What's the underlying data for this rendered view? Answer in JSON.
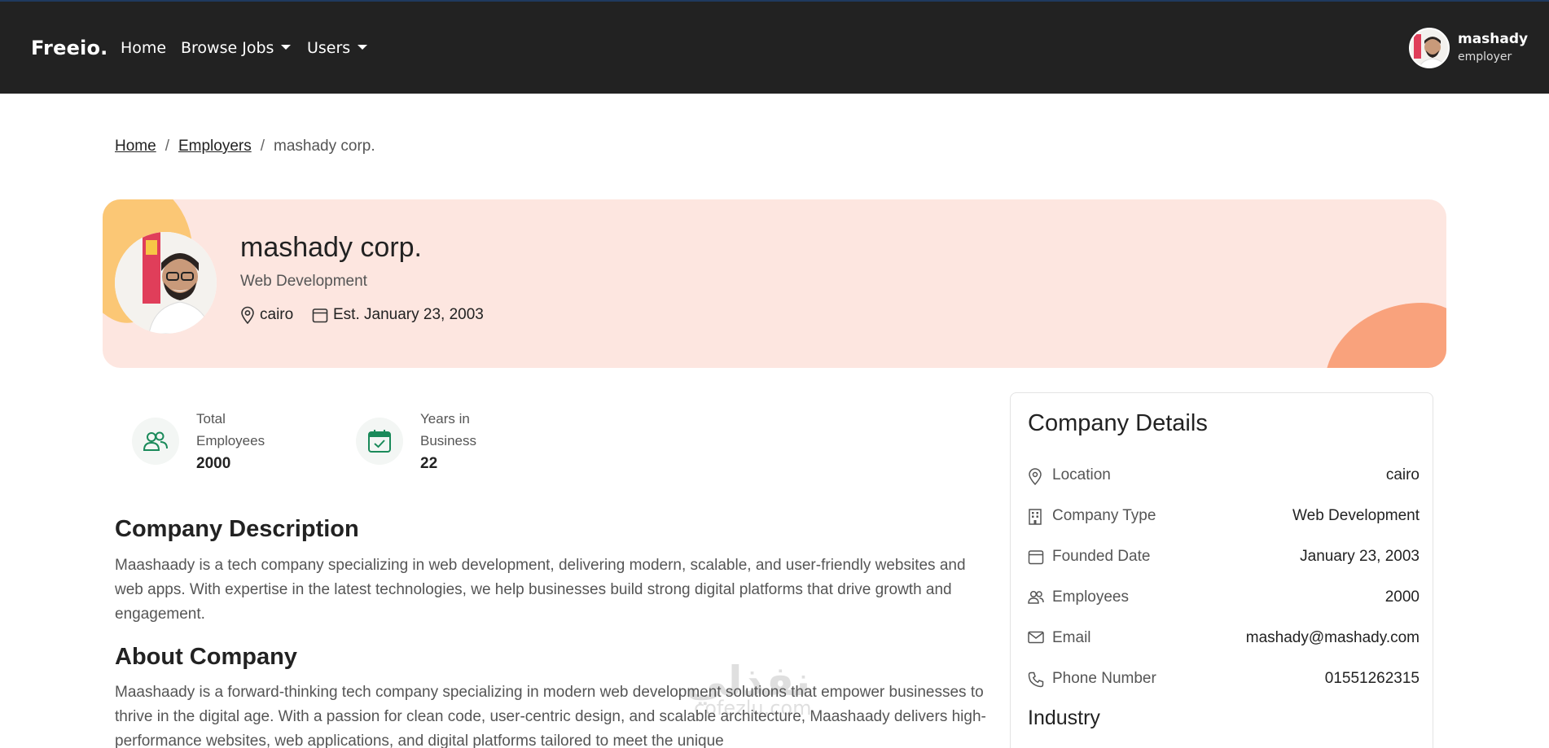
{
  "navbar": {
    "brand": "Freeio.",
    "links": [
      {
        "label": "Home"
      },
      {
        "label": "Browse Jobs"
      },
      {
        "label": "Users"
      }
    ],
    "user": {
      "name": "mashady",
      "role": "employer"
    }
  },
  "breadcrumb": {
    "items": [
      "Home",
      "Employers"
    ],
    "separator": "/",
    "current": "mashady corp."
  },
  "company": {
    "name": "mashady corp.",
    "type": "Web Development",
    "location": "cairo",
    "established": "Est. January 23, 2003"
  },
  "stats": [
    {
      "label": "Total Employees",
      "value": "2000",
      "icon": "users-icon"
    },
    {
      "label": "Years in Business",
      "value": "22",
      "icon": "calendar-check-icon"
    }
  ],
  "description": {
    "title": "Company Description",
    "text": "Maashaady is a tech company specializing in web development, delivering modern, scalable, and user-friendly websites and web apps. With expertise in the latest technologies, we help businesses build strong digital platforms that drive growth and engagement."
  },
  "about": {
    "title": "About Company",
    "text": "Maashaady is a forward-thinking tech company specializing in modern web development solutions that empower businesses to thrive in the digital age. With a passion for clean code, user-centric design, and scalable architecture, Maashaady delivers high-performance websites, web applications, and digital platforms tailored to meet the unique"
  },
  "details": {
    "title": "Company Details",
    "rows": [
      {
        "label": "Location",
        "value": "cairo",
        "icon": "location-pin-icon"
      },
      {
        "label": "Company Type",
        "value": "Web Development",
        "icon": "building-icon"
      },
      {
        "label": "Founded Date",
        "value": "January 23, 2003",
        "icon": "calendar-icon"
      },
      {
        "label": "Employees",
        "value": "2000",
        "icon": "people-icon"
      },
      {
        "label": "Email",
        "value": "mashady@mashady.com",
        "icon": "envelope-icon"
      },
      {
        "label": "Phone Number",
        "value": "01551262315",
        "icon": "phone-icon"
      }
    ],
    "industry_title": "Industry"
  },
  "watermark": {
    "main": "نفذلي",
    "sub": "cofezlu.com"
  },
  "colors": {
    "navbar": "#222222",
    "hero_bg": "#fde6e0",
    "accent_green": "#1a8a5a",
    "blob_yellow": "#fbc775",
    "blob_orange": "#f9a27c"
  }
}
